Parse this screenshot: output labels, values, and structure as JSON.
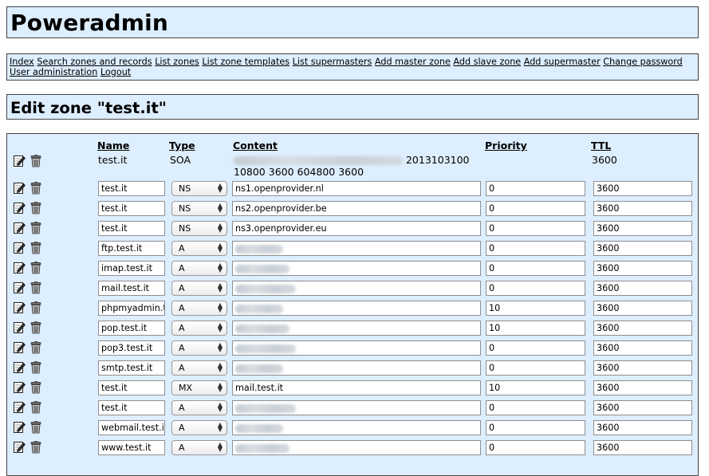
{
  "app": {
    "title": "Poweradmin"
  },
  "menu": [
    "Index",
    "Search zones and records",
    "List zones",
    "List zone templates",
    "List supermasters",
    "Add master zone",
    "Add slave zone",
    "Add supermaster",
    "Change password",
    "User administration",
    "Logout"
  ],
  "zone": {
    "title": "Edit zone \"test.it\"",
    "columns": {
      "name": "Name",
      "type": "Type",
      "content": "Content",
      "priority": "Priority",
      "ttl": "TTL"
    },
    "soa": {
      "name": "test.it",
      "type": "SOA",
      "content_serial": "2013103100",
      "content_tail": "10800 3600 604800 3600",
      "ttl": "3600"
    },
    "records": [
      {
        "name": "test.it",
        "type": "NS",
        "content": "ns1.openprovider.nl",
        "priority": "0",
        "ttl": "3600"
      },
      {
        "name": "test.it",
        "type": "NS",
        "content": "ns2.openprovider.be",
        "priority": "0",
        "ttl": "3600"
      },
      {
        "name": "test.it",
        "type": "NS",
        "content": "ns3.openprovider.eu",
        "priority": "0",
        "ttl": "3600"
      },
      {
        "name": "ftp.test.it",
        "type": "A",
        "content": "",
        "priority": "0",
        "ttl": "3600"
      },
      {
        "name": "imap.test.it",
        "type": "A",
        "content": "",
        "priority": "0",
        "ttl": "3600"
      },
      {
        "name": "mail.test.it",
        "type": "A",
        "content": "",
        "priority": "0",
        "ttl": "3600"
      },
      {
        "name": "phpmyadmin.t",
        "type": "A",
        "content": "",
        "priority": "10",
        "ttl": "3600"
      },
      {
        "name": "pop.test.it",
        "type": "A",
        "content": "",
        "priority": "10",
        "ttl": "3600"
      },
      {
        "name": "pop3.test.it",
        "type": "A",
        "content": "",
        "priority": "0",
        "ttl": "3600"
      },
      {
        "name": "smtp.test.it",
        "type": "A",
        "content": "",
        "priority": "0",
        "ttl": "3600"
      },
      {
        "name": "test.it",
        "type": "MX",
        "content": "mail.test.it",
        "priority": "10",
        "ttl": "3600"
      },
      {
        "name": "test.it",
        "type": "A",
        "content": "",
        "priority": "0",
        "ttl": "3600"
      },
      {
        "name": "webmail.test.it",
        "type": "A",
        "content": "",
        "priority": "0",
        "ttl": "3600"
      },
      {
        "name": "www.test.it",
        "type": "A",
        "content": "",
        "priority": "0",
        "ttl": "3600"
      }
    ]
  },
  "icons": {
    "edit": "edit-record-icon",
    "delete": "trash-icon"
  },
  "colors": {
    "panel_bg": "#ddeeff",
    "border": "#444444"
  }
}
